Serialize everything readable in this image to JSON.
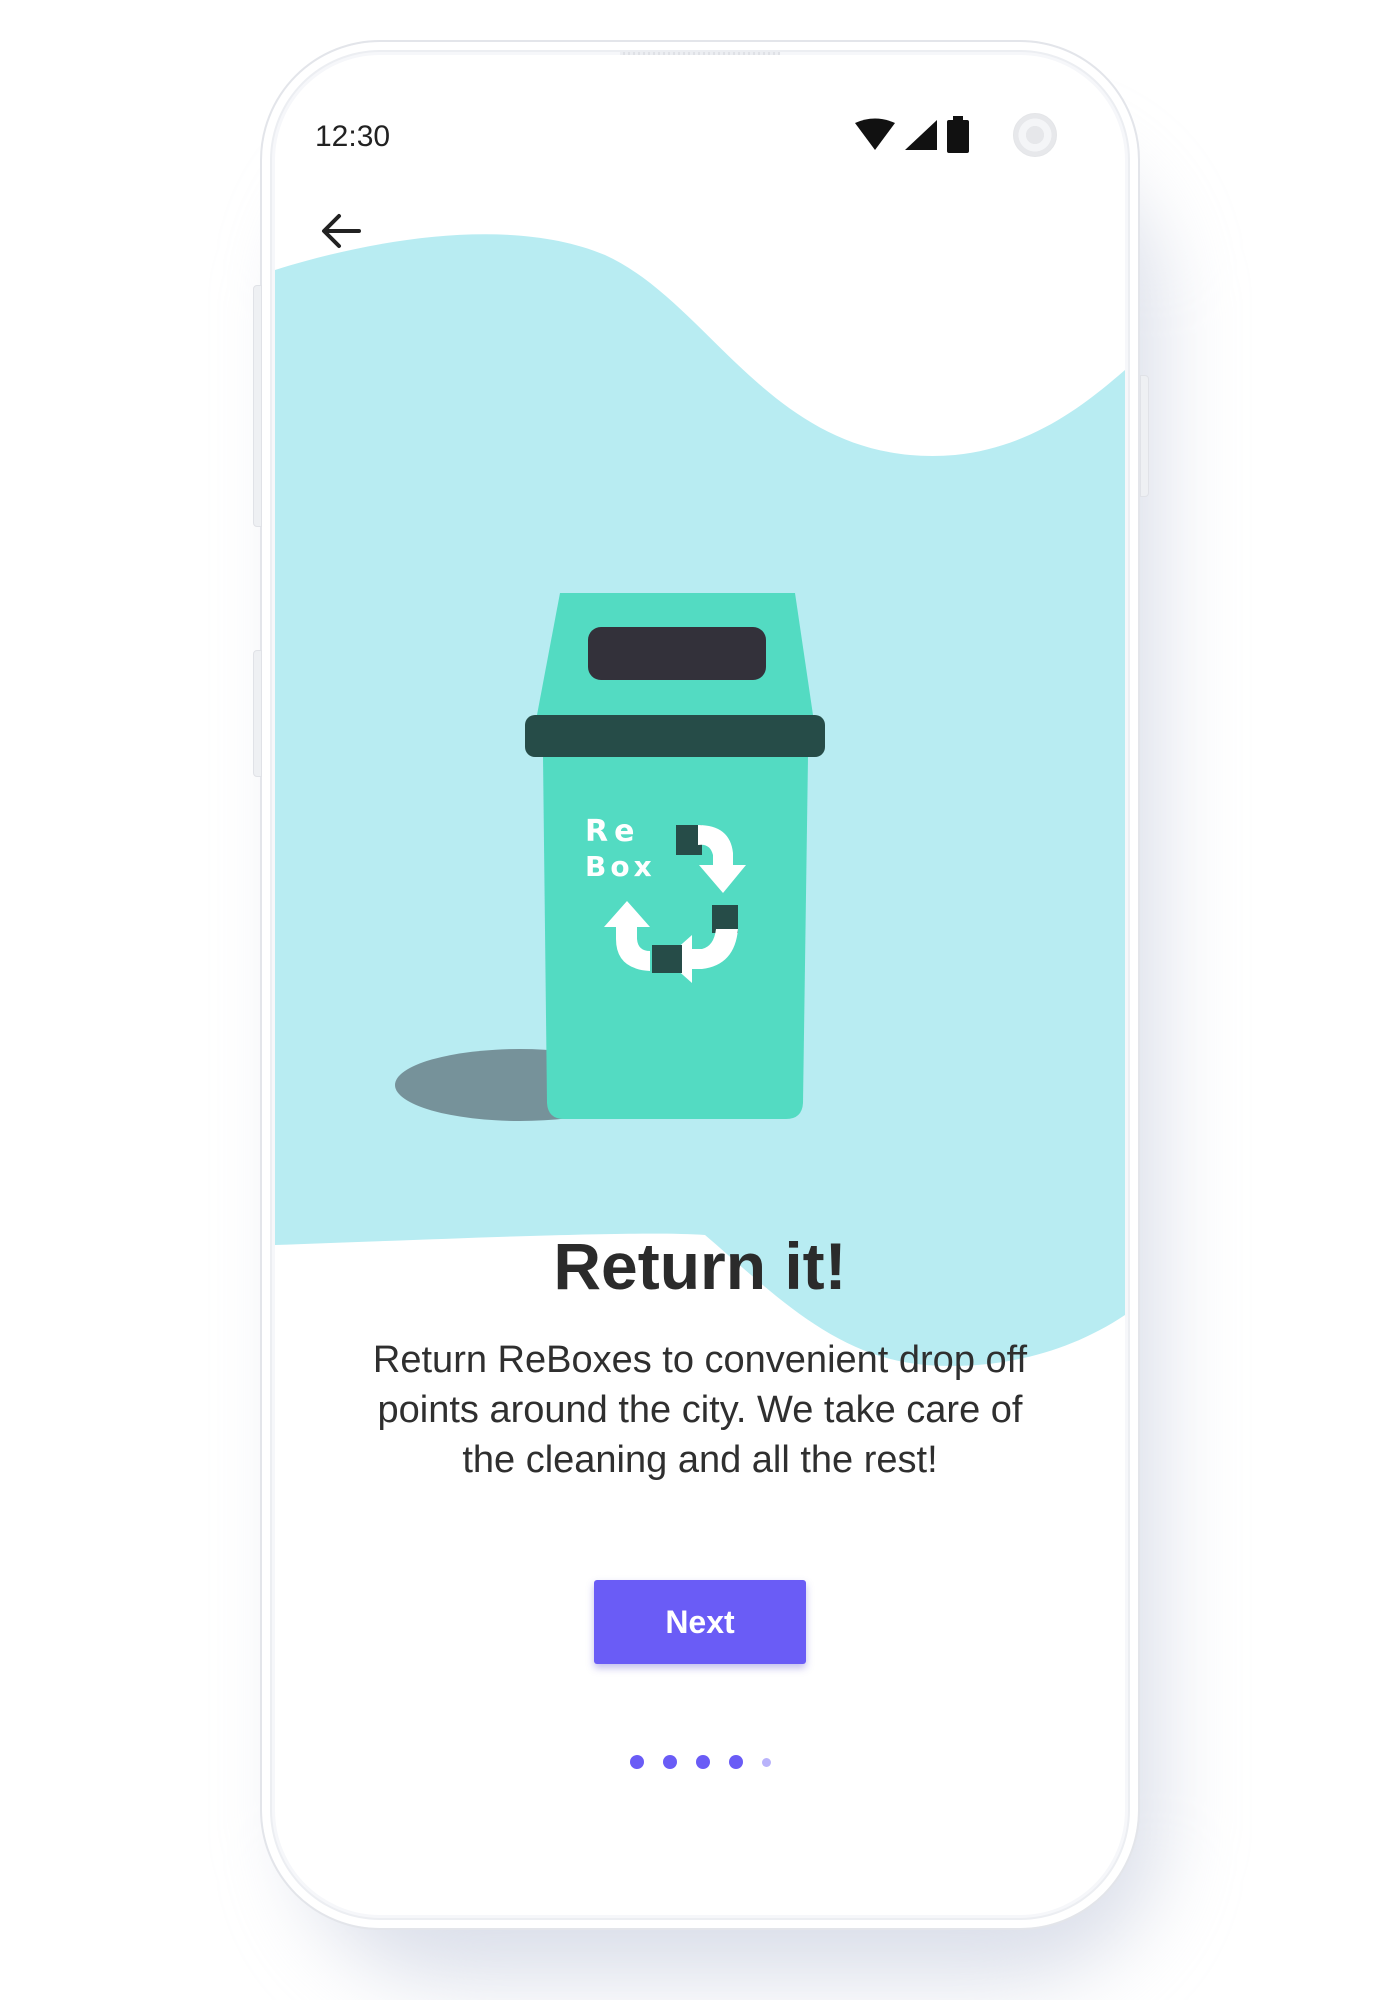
{
  "status_bar": {
    "time": "12:30",
    "icons": [
      "wifi-icon",
      "cell-signal-icon",
      "battery-icon"
    ]
  },
  "nav": {
    "back_icon": "arrow-left-icon"
  },
  "illustration": {
    "name": "recycle-bin-illustration",
    "brand_line1": "Re",
    "brand_line2": "Box",
    "icon": "recycle-icon"
  },
  "onboarding": {
    "title": "Return it!",
    "description": "Return ReBoxes to convenient drop off points around the city. We take care of the cleaning and all the rest!",
    "next_label": "Next",
    "pagination": {
      "total": 5,
      "current": 5
    }
  },
  "colors": {
    "accent": "#6a5cf6",
    "wave": "#b8ecf2",
    "bin": "#53dbc2",
    "bin_dark": "#264c48",
    "text": "#2b2b2b"
  }
}
